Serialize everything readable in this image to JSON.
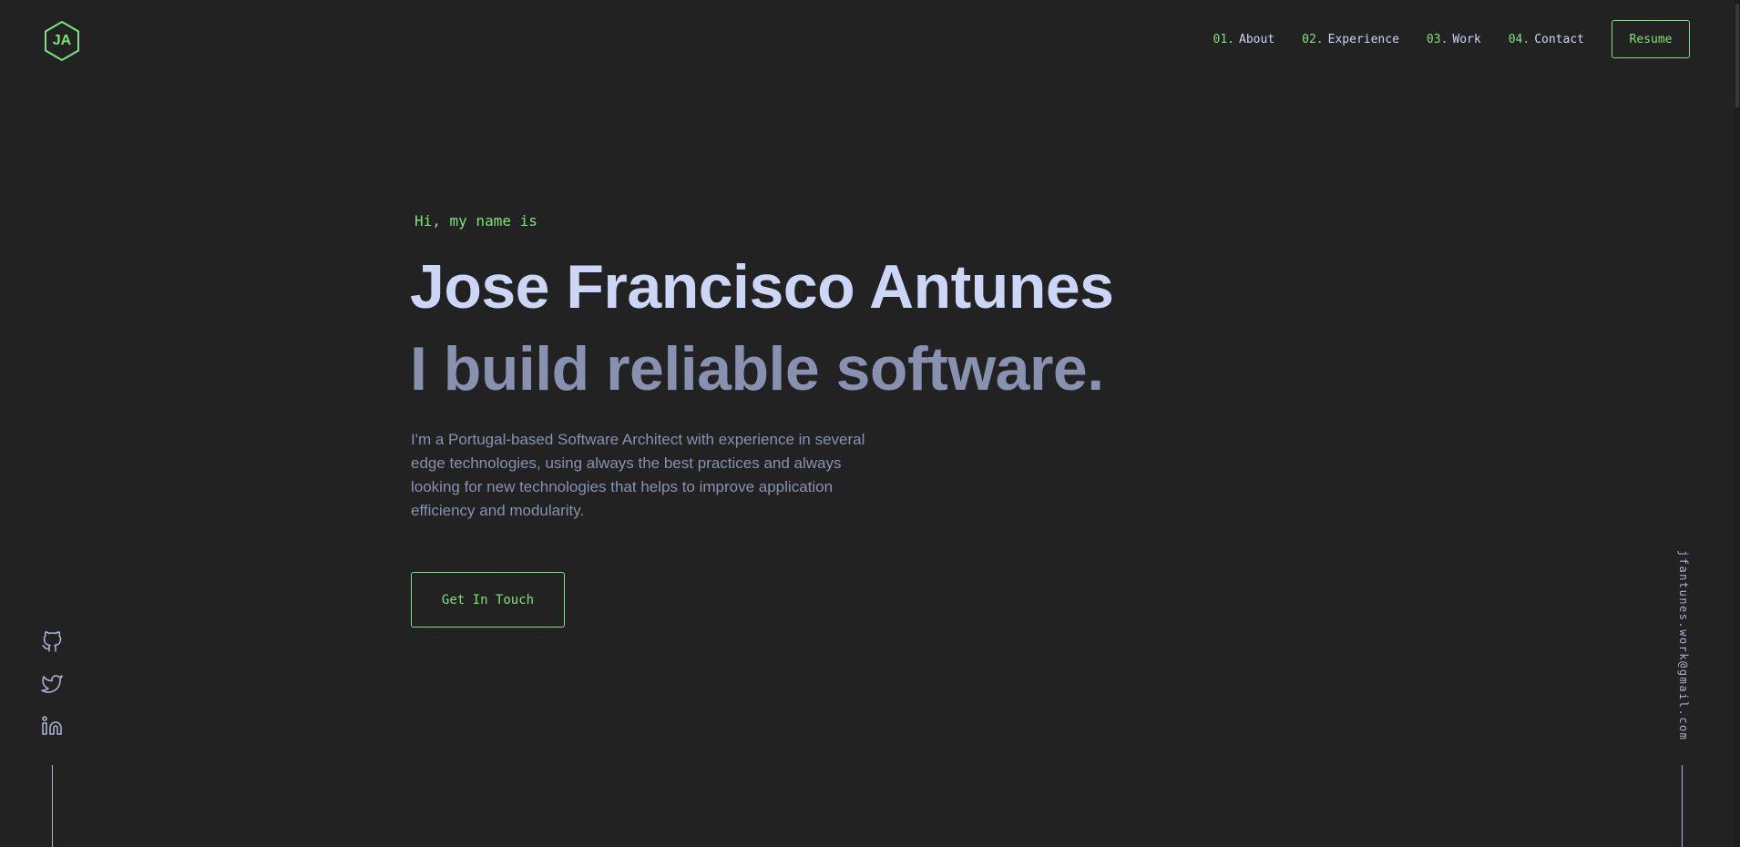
{
  "header": {
    "logo_text": "JA",
    "nav": [
      {
        "num": "01.",
        "label": "About"
      },
      {
        "num": "02.",
        "label": "Experience"
      },
      {
        "num": "03.",
        "label": "Work"
      },
      {
        "num": "04.",
        "label": "Contact"
      }
    ],
    "resume_label": "Resume"
  },
  "hero": {
    "intro": "Hi, my name is",
    "name": "Jose Francisco Antunes",
    "tagline": "I build reliable software.",
    "description": "I'm a Portugal-based Software Architect with experience in several edge technologies, using always the best practices and always looking for new technologies that helps to improve application efficiency and modularity.",
    "cta_label": "Get In Touch"
  },
  "social": {
    "icons": [
      "github-icon",
      "twitter-icon",
      "linkedin-icon"
    ]
  },
  "email": "jfantunes.work@gmail.com",
  "colors": {
    "background": "#222222",
    "accent": "#7ee27b",
    "heading": "#ccd6f6",
    "text": "#8892b0",
    "rail": "#a8b2d1"
  }
}
